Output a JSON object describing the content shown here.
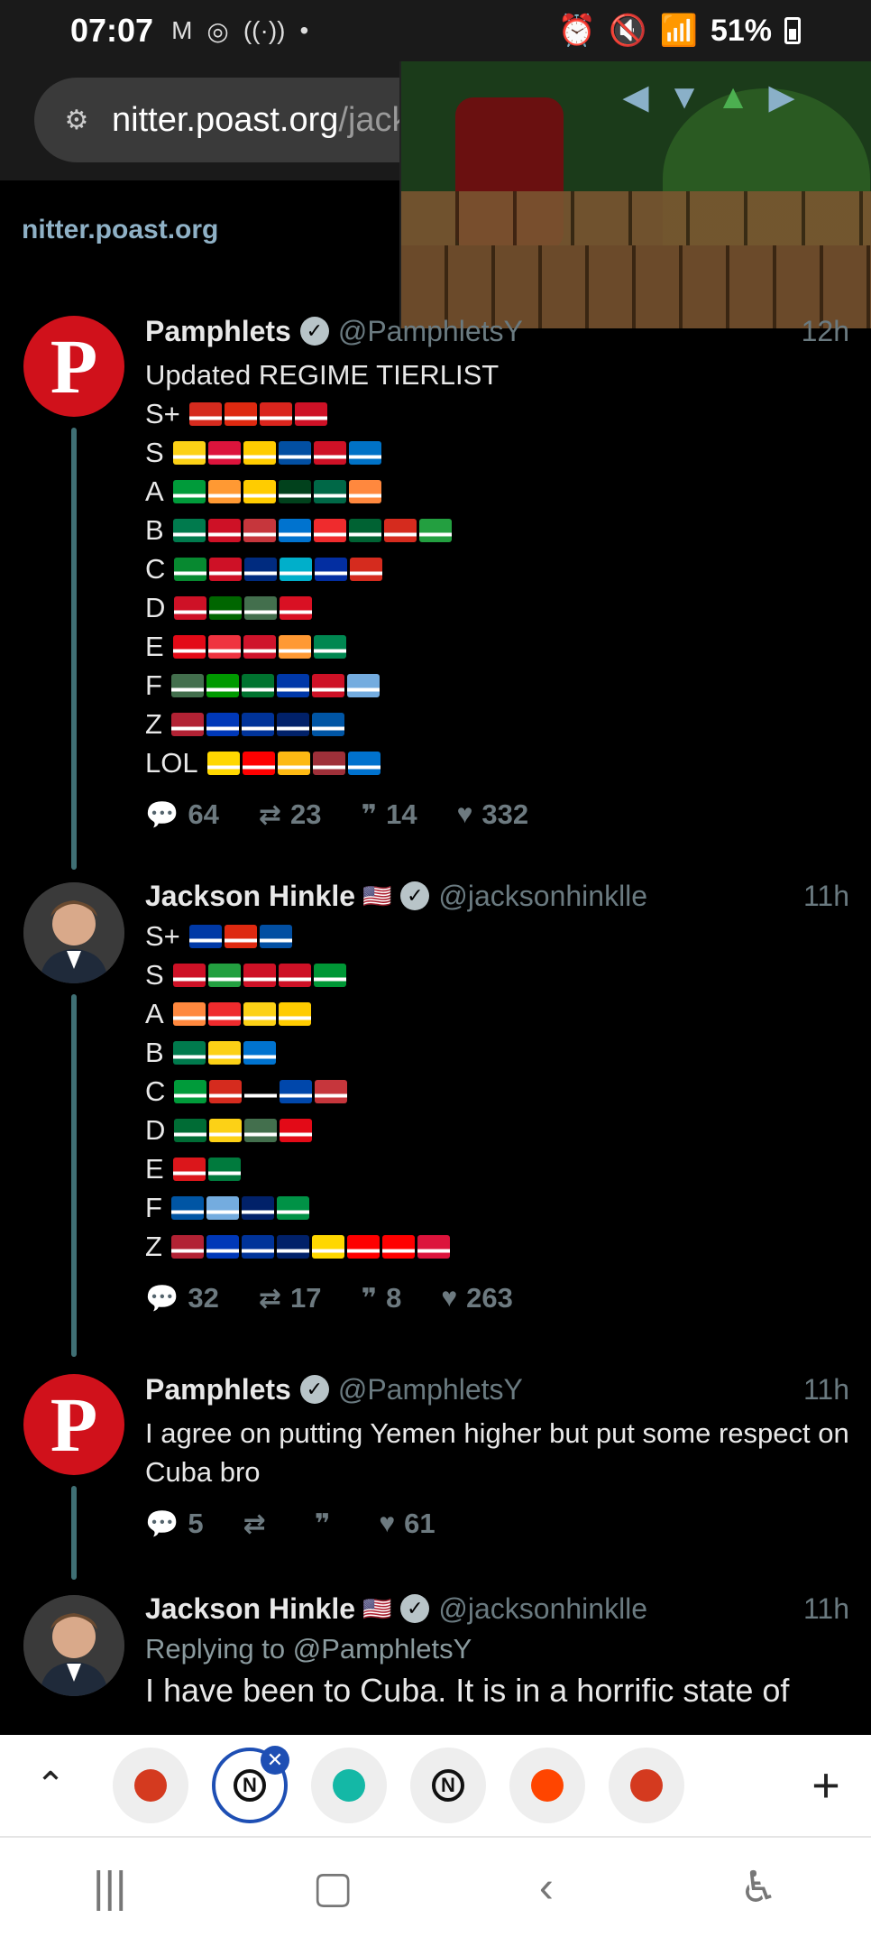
{
  "status_bar": {
    "time": "07:07",
    "left_icons": [
      "gmail-icon",
      "messenger-icon",
      "broadcast-icon",
      "dot"
    ],
    "battery": "51%"
  },
  "browser": {
    "url_domain": "nitter.poast.org",
    "url_path": "/jack"
  },
  "page": {
    "site_name": "nitter.poast.org"
  },
  "tweets": [
    {
      "author": "Pamphlets",
      "handle": "@PamphletsY",
      "time": "12h",
      "avatar_letter": "P",
      "title": "Updated REGIME TIERLIST",
      "tiers": [
        {
          "label": "S+",
          "flags": [
            "#d52b1e",
            "#de2910",
            "#da251d",
            "#ce1126"
          ]
        },
        {
          "label": "S",
          "flags": [
            "#fcd116",
            "#dc143c",
            "#ffcc00",
            "#024fa2",
            "#ce1126",
            "#0072c6"
          ]
        },
        {
          "label": "A",
          "flags": [
            "#009b3a",
            "#ff9933",
            "#ffcc00",
            "#01411c",
            "#006847",
            "#ff883e"
          ]
        },
        {
          "label": "B",
          "flags": [
            "#007a4d",
            "#ce1126",
            "#c6363c",
            "#0073cf",
            "#ef2b2d",
            "#006233",
            "#d52b1e",
            "#239f40"
          ]
        },
        {
          "label": "C",
          "flags": [
            "#078930",
            "#ce1126",
            "#002b7f",
            "#00afca",
            "#032ea1",
            "#d52b1e"
          ]
        },
        {
          "label": "D",
          "flags": [
            "#ce1126",
            "#006600",
            "#436f4d",
            "#d91023"
          ]
        },
        {
          "label": "E",
          "flags": [
            "#e30a17",
            "#ef3340",
            "#cf142b",
            "#ff9933",
            "#008751"
          ]
        },
        {
          "label": "F",
          "flags": [
            "#436f4d",
            "#009900",
            "#00732f",
            "#0038a8",
            "#ce1126",
            "#74acdf"
          ]
        },
        {
          "label": "Z",
          "flags": [
            "#b22234",
            "#0038b8",
            "#003399",
            "#012169",
            "#0055a4"
          ]
        },
        {
          "label": "LOL",
          "flags": [
            "#ffd700",
            "#fe0000",
            "#fdb913",
            "#9e3039",
            "#0072ce"
          ]
        }
      ],
      "stats": {
        "replies": "64",
        "retweets": "23",
        "quotes": "14",
        "likes": "332"
      }
    },
    {
      "author": "Jackson Hinkle",
      "handle": "@jacksonhinklle",
      "time": "11h",
      "tiers": [
        {
          "label": "S+",
          "flags": [
            "#0039a6",
            "#de2910",
            "#024fa2"
          ]
        },
        {
          "label": "S",
          "flags": [
            "#ce1126",
            "#239f40",
            "#ce1126",
            "#ce1126",
            "#009736"
          ]
        },
        {
          "label": "A",
          "flags": [
            "#ff883e",
            "#ef2b2d",
            "#fcd116",
            "#ffcc00"
          ]
        },
        {
          "label": "B",
          "flags": [
            "#007a4d",
            "#fcd116",
            "#0073cf"
          ]
        },
        {
          "label": "C",
          "flags": [
            "#009b3a",
            "#d52b1e",
            "#000000",
            "#0047ab",
            "#c6363c"
          ]
        },
        {
          "label": "D",
          "flags": [
            "#006c35",
            "#fcd116",
            "#436f4d",
            "#e30a17"
          ]
        },
        {
          "label": "E",
          "flags": [
            "#db161b",
            "#007a3d"
          ]
        },
        {
          "label": "F",
          "flags": [
            "#0055a4",
            "#74acdf",
            "#012169",
            "#009246"
          ]
        },
        {
          "label": "Z",
          "flags": [
            "#b22234",
            "#0038b8",
            "#003399",
            "#012169",
            "#ffd700",
            "#fe0000",
            "#ff0000",
            "#dc143c"
          ]
        }
      ],
      "stats": {
        "replies": "32",
        "retweets": "17",
        "quotes": "8",
        "likes": "263"
      }
    },
    {
      "author": "Pamphlets",
      "handle": "@PamphletsY",
      "time": "11h",
      "avatar_letter": "P",
      "text": "I agree on putting Yemen higher but put some respect on Cuba bro",
      "stats": {
        "replies": "5",
        "retweets": "",
        "quotes": "",
        "likes": "61"
      }
    },
    {
      "author": "Jackson Hinkle",
      "handle": "@jacksonhinklle",
      "time": "11h",
      "replying_prefix": "Replying to",
      "replying_to": "@PamphletsY",
      "text": "I have been to Cuba. It is in a horrific state of"
    }
  ],
  "tab_bar": {
    "tabs": [
      {
        "name": "tab-1",
        "color": "#d43a1f"
      },
      {
        "name": "tab-2",
        "color": "#111111",
        "active": true
      },
      {
        "name": "tab-3",
        "color": "#14b8a6"
      },
      {
        "name": "tab-4",
        "color": "#111111"
      },
      {
        "name": "tab-5",
        "color": "#ff4500"
      },
      {
        "name": "tab-6",
        "color": "#d43a1f"
      }
    ],
    "close_label": "✕",
    "plus_label": "+"
  },
  "colors": {
    "background": "#000000",
    "thread_line": "#3f6f74",
    "pamphlets_red": "#d0111b",
    "accent_blue": "#1e4fb4",
    "site_name": "#8fb1c6"
  }
}
